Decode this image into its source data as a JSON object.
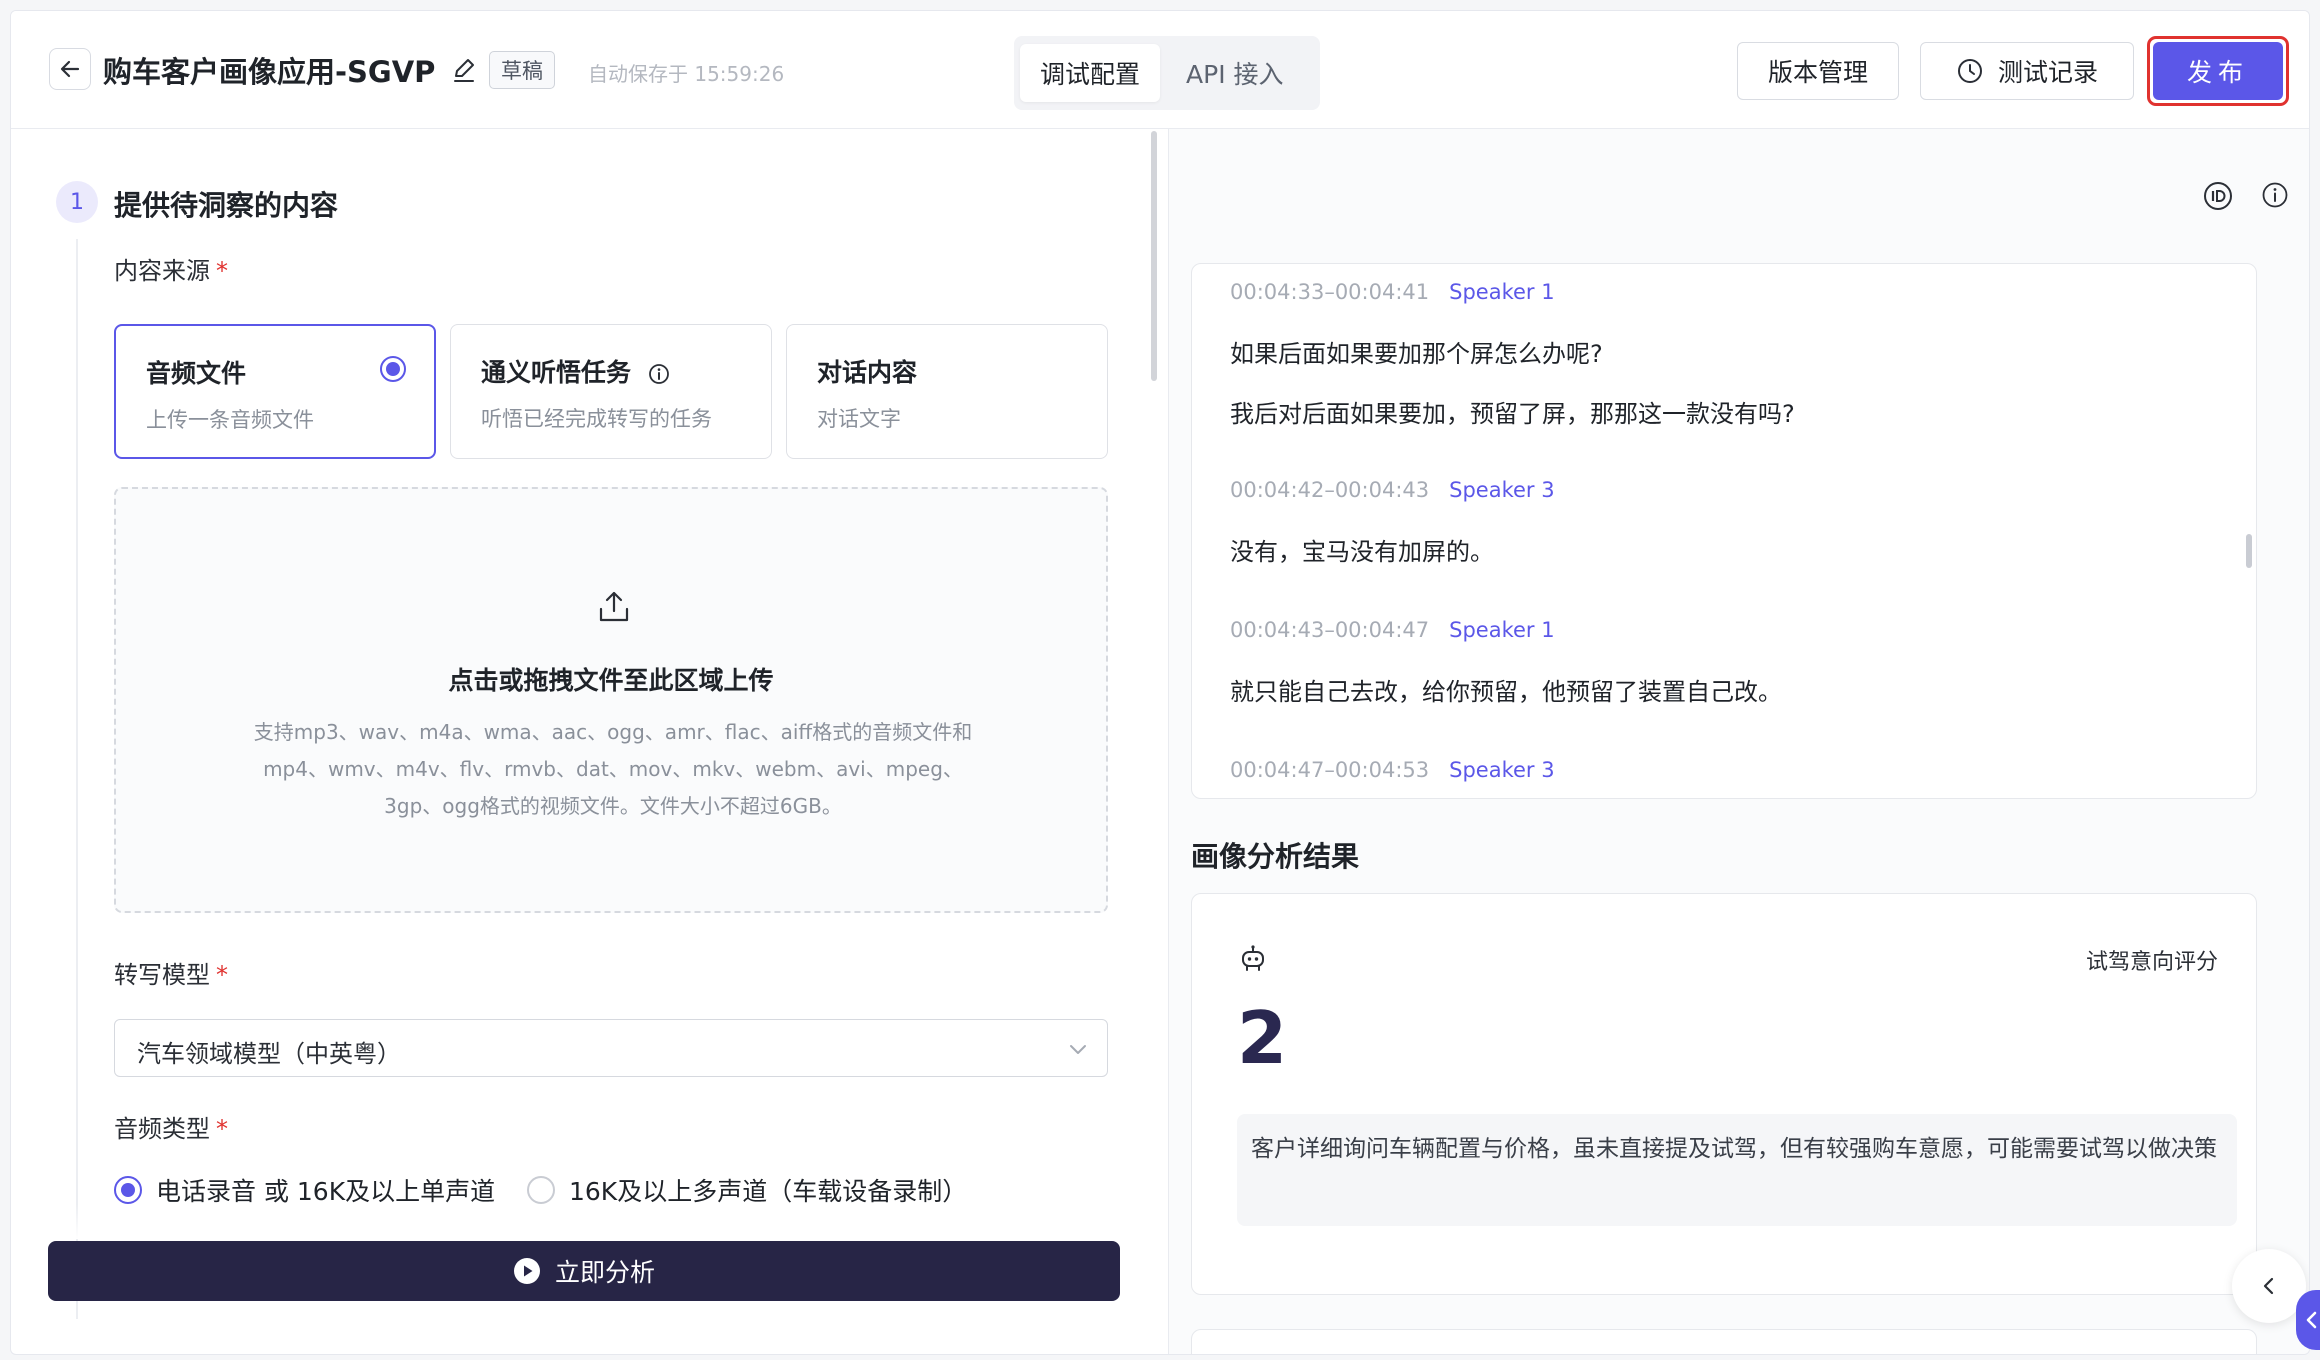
{
  "header": {
    "title": "购车客户画像应用-SGVP",
    "status_badge": "草稿",
    "autosave": "自动保存于 15:59:26",
    "tabs": [
      {
        "label": "调试配置",
        "active": true
      },
      {
        "label": "API 接入",
        "active": false
      }
    ],
    "version_button": "版本管理",
    "history_button": "测试记录",
    "publish_button": "发布"
  },
  "left": {
    "step_number": "1",
    "step_title": "提供待洞察的内容",
    "source_label": "内容来源",
    "required_mark": "*",
    "source_options": [
      {
        "title": "音频文件",
        "desc": "上传一条音频文件",
        "selected": true
      },
      {
        "title": "通义听悟任务",
        "desc": "听悟已经完成转写的任务",
        "selected": false
      },
      {
        "title": "对话内容",
        "desc": "对话文字",
        "selected": false
      }
    ],
    "upload": {
      "title": "点击或拖拽文件至此区域上传",
      "desc": "支持mp3、wav、m4a、wma、aac、ogg、amr、flac、aiff格式的音频文件和mp4、wmv、m4v、flv、rmvb、dat、mov、mkv、webm、avi、mpeg、3gp、ogg格式的视频文件。文件大小不超过6GB。"
    },
    "model_label": "转写模型",
    "model_value": "汽车领域模型（中英粤）",
    "audio_type_label": "音频类型",
    "audio_types": [
      {
        "label": "电话录音 或 16K及以上单声道",
        "selected": true
      },
      {
        "label": "16K及以上多声道（车载设备录制）",
        "selected": false
      }
    ],
    "analyze_button": "立即分析"
  },
  "right": {
    "transcript": [
      {
        "time": "00:04:33–00:04:41",
        "speaker": "Speaker 1",
        "lines": [
          "如果后面如果要加那个屏怎么办呢?",
          "我后对后面如果要加，预留了屏，那那这一款没有吗?"
        ]
      },
      {
        "time": "00:04:42–00:04:43",
        "speaker": "Speaker 3",
        "lines": [
          "没有，宝马没有加屏的。"
        ]
      },
      {
        "time": "00:04:43–00:04:47",
        "speaker": "Speaker 1",
        "lines": [
          "就只能自己去改，给你预留，他预留了装置自己改。"
        ]
      },
      {
        "time": "00:04:47–00:04:53",
        "speaker": "Speaker 3",
        "lines": []
      }
    ],
    "section_title": "画像分析结果",
    "result": {
      "label": "试驾意向评分",
      "score": "2",
      "desc": "客户详细询问车辆配置与价格，虽未直接提及试驾，但有较强购车意愿，可能需要试驾以做决策"
    }
  },
  "colors": {
    "accent": "#5b57e8",
    "primary_dark": "#272546",
    "publish_highlight": "#e0322f"
  },
  "icons": [
    "back-arrow-icon",
    "edit-icon",
    "clock-icon",
    "info-icon",
    "radio-icon",
    "upload-icon",
    "chevron-down-icon",
    "play-icon",
    "id-icon",
    "robot-icon",
    "chevron-left-icon"
  ]
}
